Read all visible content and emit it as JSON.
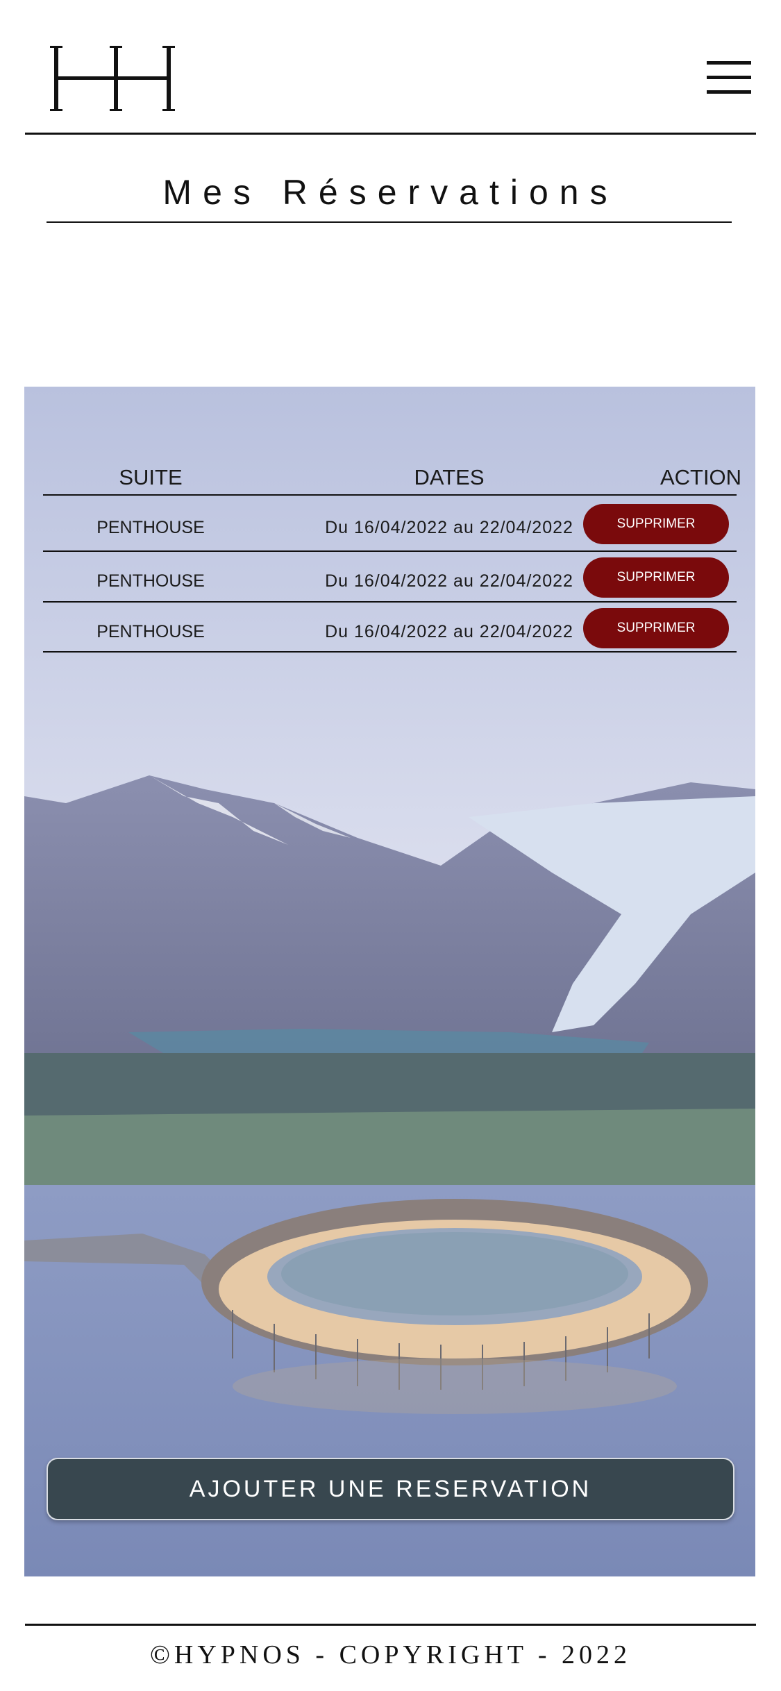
{
  "brand": {
    "logo_text": "HH"
  },
  "header": {
    "menu_icon": "hamburger-menu-icon"
  },
  "page_title": "Mes Réservations",
  "table": {
    "headers": {
      "suite": "SUITE",
      "dates": "DATES",
      "action": "ACTION"
    },
    "rows": [
      {
        "suite": "PENTHOUSE",
        "dates": "Du 16/04/2022 au 22/04/2022",
        "action": "SUPPRIMER"
      },
      {
        "suite": "PENTHOUSE",
        "dates": "Du 16/04/2022 au 22/04/2022",
        "action": "SUPPRIMER"
      },
      {
        "suite": "PENTHOUSE",
        "dates": "Du 16/04/2022 au 22/04/2022",
        "action": "SUPPRIMER"
      }
    ]
  },
  "add_button": "AJOUTER UNE RESERVATION",
  "footer": {
    "copyright": "©HYPNOS - COPYRIGHT - 2022"
  },
  "colors": {
    "delete_button": "#7a0a0c",
    "add_button": "#38474f",
    "hero_tint": "#c9d0e6"
  }
}
